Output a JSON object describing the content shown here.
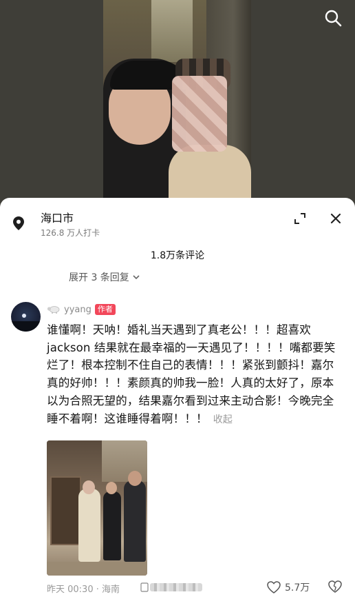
{
  "top": {
    "search_icon": "search-icon"
  },
  "location": {
    "title": "海口市",
    "checkins": "126.8 万人打卡",
    "pin_icon": "location-pin-icon"
  },
  "comments_header": {
    "count": "1.8万条评论",
    "expand_replies": "展开 3 条回复"
  },
  "comment": {
    "username": "yyang",
    "author_tag": "作者",
    "text": "谁懂啊！天呐！婚礼当天遇到了真老公！！！超喜欢jackson 结果就在最幸福的一天遇见了！！！！嘴都要笑烂了！根本控制不住自己的表情！！！紧张到颤抖！嘉尔真的好帅！！！素颜真的帅我一脸！人真的太好了，原本以为合照无望的，结果嘉尔看到过来主动合影！今晚完全睡不着啊！这谁睡得着啊！！！",
    "collapse": "收起",
    "time_location": "昨天 00:30 · 海南",
    "likes": "5.7万"
  },
  "colors": {
    "author_tag": "#f2475a",
    "secondary_text": "#999999"
  }
}
